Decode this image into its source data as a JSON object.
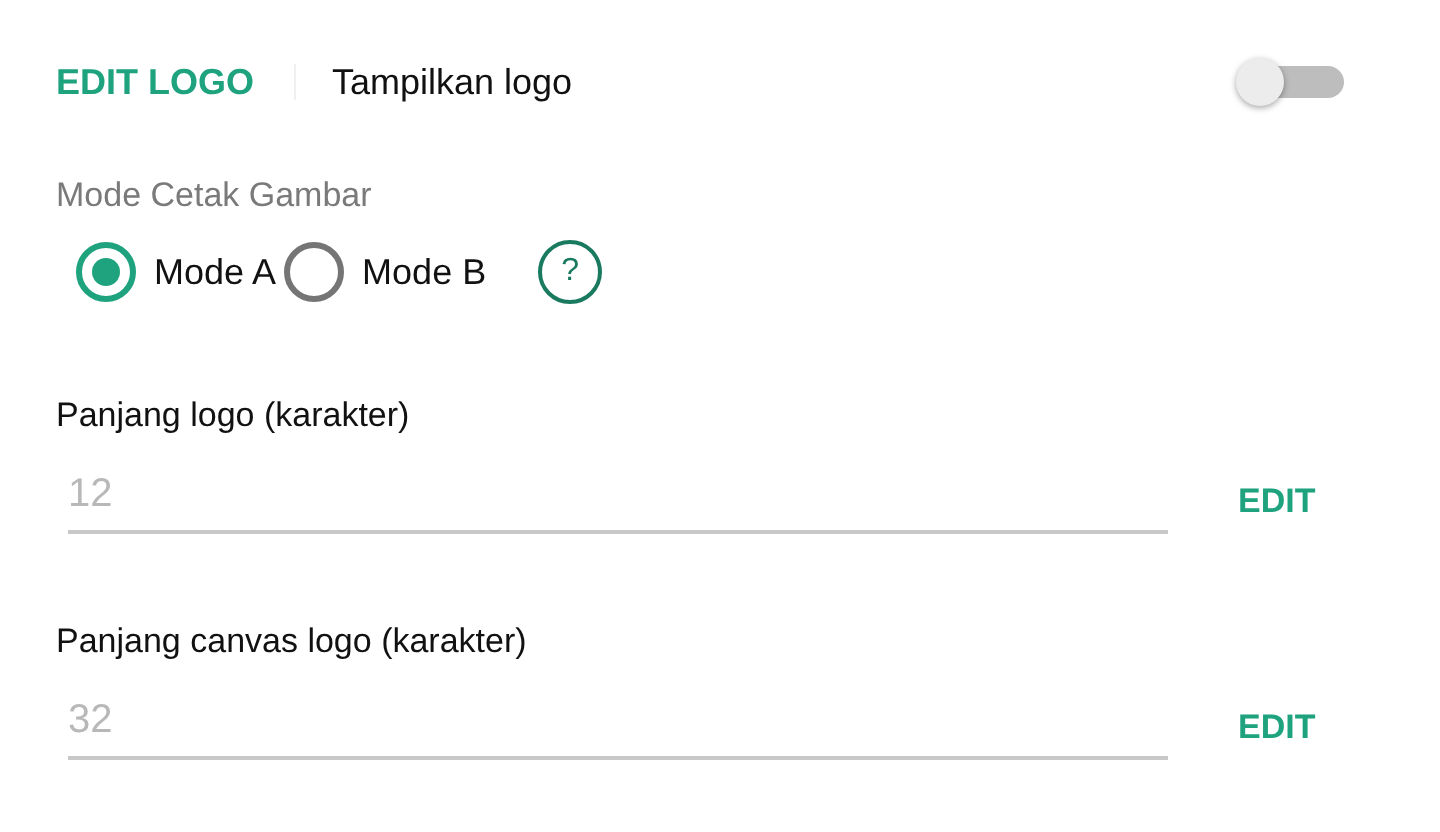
{
  "header": {
    "edit_button": "EDIT LOGO",
    "toggle_label": "Tampilkan logo",
    "toggle_on": false
  },
  "print_mode": {
    "label": "Mode Cetak Gambar",
    "help": "?",
    "options": [
      {
        "label": "Mode A",
        "selected": true
      },
      {
        "label": "Mode B",
        "selected": false
      }
    ]
  },
  "fields": [
    {
      "label": "Panjang logo (karakter)",
      "value": "12",
      "button": "EDIT"
    },
    {
      "label": "Panjang canvas logo (karakter)",
      "value": "32",
      "button": "EDIT"
    }
  ]
}
